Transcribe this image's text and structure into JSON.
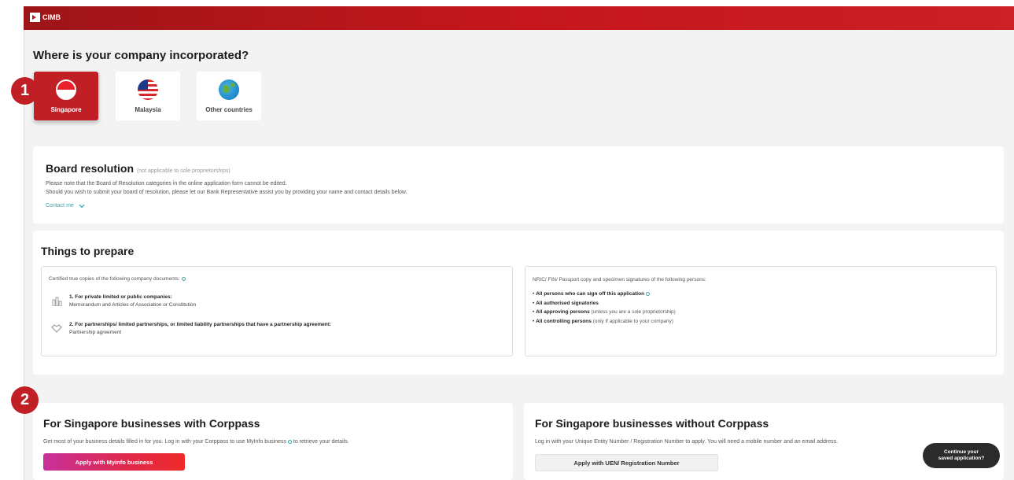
{
  "header": {
    "brand": "CIMB"
  },
  "incorporation": {
    "title": "Where is your company incorporated?",
    "options": [
      {
        "label": "Singapore",
        "selected": true
      },
      {
        "label": "Malaysia",
        "selected": false
      },
      {
        "label": "Other countries",
        "selected": false
      }
    ]
  },
  "steps": {
    "one": "1",
    "two": "2"
  },
  "board": {
    "title": "Board resolution",
    "note": "(not applicable to sole proprietorships)",
    "line1": "Please note that the Board of Resolution categories in the online application form cannot be edited.",
    "line2": "Should you wish to submit your board of resolution, please let our Bank Representative assist you by providing your name and contact details below.",
    "contact": "Contact me"
  },
  "prepare": {
    "title": "Things to prepare",
    "left": {
      "intro": "Certified true copies of the following company documents:",
      "item1_title": "1. For private limited or public companies:",
      "item1_desc": "Memorandum and Articles of Association or Constitution",
      "item2_title": "2. For partnerships/ limited partnerships, or limited liability partnerships that have a partnership agreement:",
      "item2_desc": "Partnership agreement"
    },
    "right": {
      "intro": "NRIC/ FIN/ Passport copy and specimen signatures of the following persons:",
      "b1": "All persons who can sign off this application",
      "b2": "All authorised signatories",
      "b3": "All approving persons",
      "b3_note": "(unless you are a sole proprietorship)",
      "b4": "All controlling persons",
      "b4_note": "(only if applicable to your company)"
    }
  },
  "corppass": {
    "title": "For Singapore businesses with Corppass",
    "desc_a": "Get most of your business details filled in for you. Log in with your Corppass to use MyInfo business",
    "desc_b": "to retrieve your details.",
    "button": "Apply with Myinfo business"
  },
  "no_corppass": {
    "title": "For Singapore businesses without Corppass",
    "desc": "Log in with your Unique Entity Number / Registration Number to apply. You will need a mobile number and an email address.",
    "button": "Apply with UEN/ Registration Number"
  },
  "continue": {
    "line1": "Continue your",
    "line2": "saved application?"
  },
  "colors": {
    "brand_red": "#c01f25",
    "link_teal": "#33aaaa"
  }
}
